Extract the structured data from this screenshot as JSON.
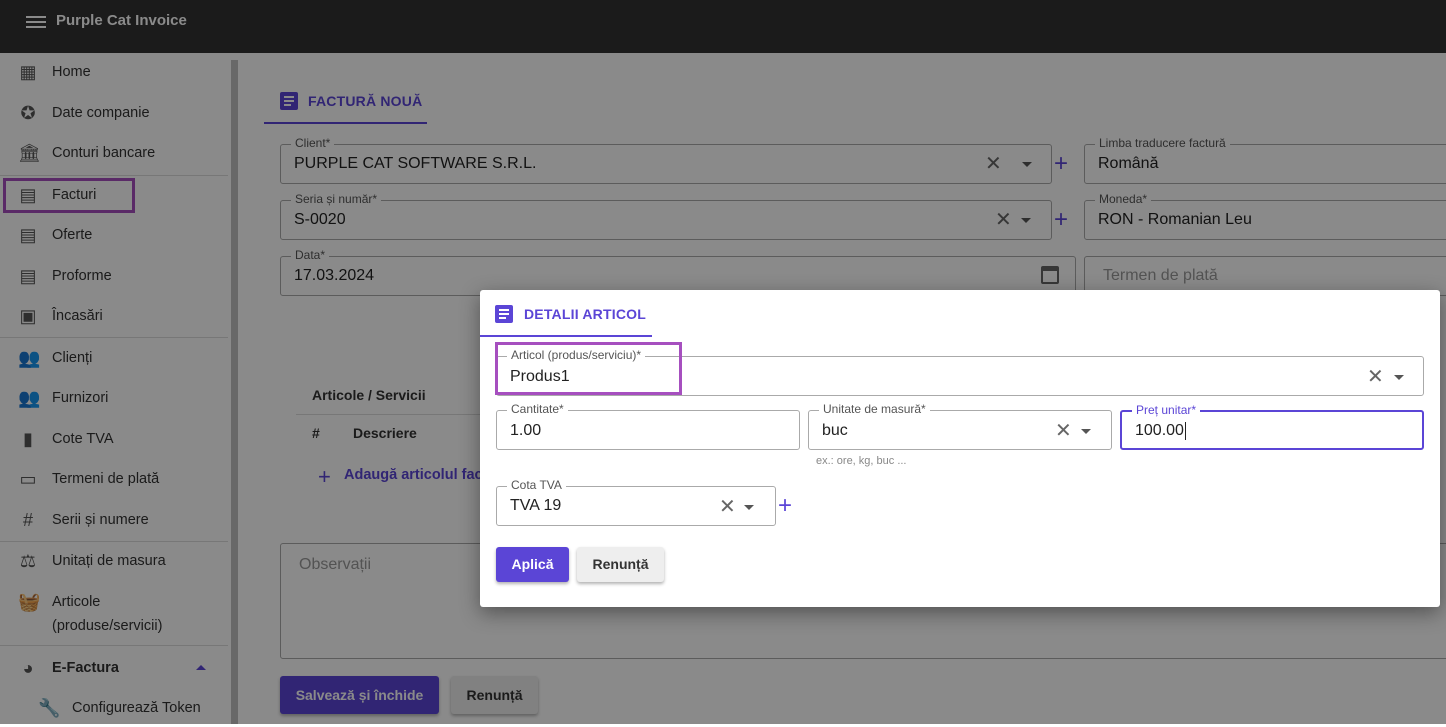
{
  "app": {
    "title": "Purple Cat Invoice"
  },
  "sidebar": {
    "items": [
      {
        "label": "Home",
        "icon": "dashboard-icon"
      },
      {
        "label": "Date companie",
        "icon": "badge-icon"
      },
      {
        "label": "Conturi bancare",
        "icon": "bank-icon"
      },
      {
        "label": "Facturi",
        "icon": "document-icon"
      },
      {
        "label": "Oferte",
        "icon": "document-icon"
      },
      {
        "label": "Proforme",
        "icon": "document-icon"
      },
      {
        "label": "Încasări",
        "icon": "money-icon"
      },
      {
        "label": "Clienți",
        "icon": "people-icon"
      },
      {
        "label": "Furnizori",
        "icon": "people-icon"
      },
      {
        "label": "Cote TVA",
        "icon": "book-icon"
      },
      {
        "label": "Termeni de plată",
        "icon": "card-icon"
      },
      {
        "label": "Serii și numere",
        "icon": "hash-icon"
      },
      {
        "label": "Unitați de masura",
        "icon": "scale-icon"
      },
      {
        "label": "Articole",
        "label2": "(produse/servicii)",
        "icon": "basket-icon"
      },
      {
        "label": "E-Factura",
        "icon": "pie-icon"
      },
      {
        "label": "Configurează Token",
        "icon": "wrench-icon"
      }
    ]
  },
  "invoice": {
    "tab": "FACTURĂ NOUĂ",
    "client_label": "Client*",
    "client_value": "PURPLE CAT SOFTWARE S.R.L.",
    "lang_label": "Limba traducere factură",
    "lang_value": "Română",
    "series_label": "Seria și număr*",
    "series_value": "S-0020",
    "currency_label": "Moneda*",
    "currency_value": "RON - Romanian Leu",
    "date_label": "Data*",
    "date_value": "17.03.2024",
    "terms_placeholder": "Termen de plată",
    "items_title": "Articole / Servicii",
    "col_num": "#",
    "col_desc": "Descriere",
    "add_item": "Adaugă articolul fact",
    "notes_placeholder": "Observații",
    "save_button": "Salvează și închide",
    "cancel_button": "Renunță"
  },
  "dialog": {
    "tab": "DETALII ARTICOL",
    "article_label": "Articol (produs/serviciu)*",
    "article_value": "Produs1",
    "qty_label": "Cantitate*",
    "qty_value": "1.00",
    "unit_label": "Unitate de masură*",
    "unit_value": "buc",
    "unit_hint": "ex.: ore, kg, buc ...",
    "price_label": "Preț unitar*",
    "price_value": "100.00",
    "vat_label": "Cota TVA",
    "vat_value": "TVA 19",
    "apply_button": "Aplică",
    "cancel_button": "Renunță"
  },
  "colors": {
    "accent": "#5b45d6",
    "highlight": "#a64fbf",
    "appbar": "#333333"
  }
}
